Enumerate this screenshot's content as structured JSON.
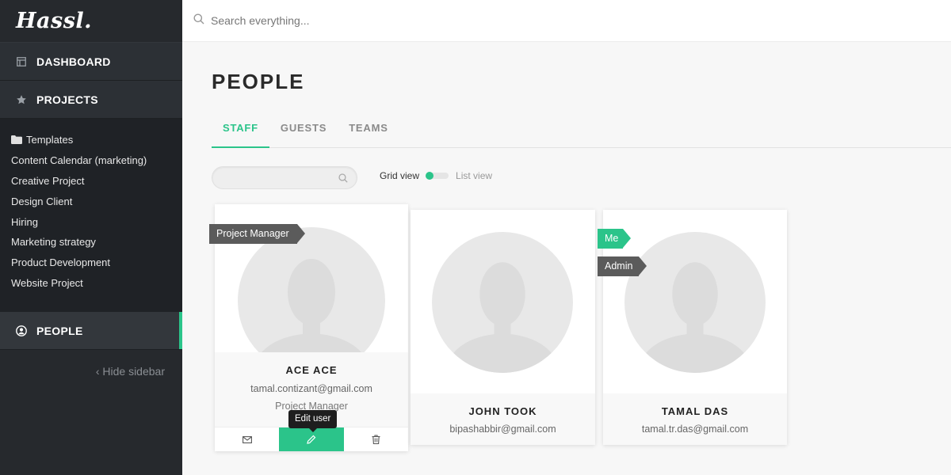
{
  "app": {
    "logo": "Hassl."
  },
  "sidebar": {
    "nav": [
      {
        "label": "DASHBOARD",
        "icon": "calendar-icon"
      },
      {
        "label": "PROJECTS",
        "icon": "star-icon"
      }
    ],
    "projects": [
      {
        "label": "Templates",
        "icon": "folder-icon"
      },
      {
        "label": "Content Calendar (marketing)"
      },
      {
        "label": "Creative Project"
      },
      {
        "label": "Design Client"
      },
      {
        "label": "Hiring"
      },
      {
        "label": "Marketing strategy"
      },
      {
        "label": "Product Development"
      },
      {
        "label": "Website Project"
      }
    ],
    "people": {
      "label": "PEOPLE",
      "icon": "user-circle-icon"
    },
    "hide_sidebar": "Hide sidebar"
  },
  "search": {
    "placeholder": "Search everything..."
  },
  "page": {
    "title": "PEOPLE",
    "tabs": [
      "STAFF",
      "GUESTS",
      "TEAMS"
    ],
    "active_tab": "STAFF",
    "people_search_placeholder": "",
    "view_toggle": {
      "grid": "Grid view",
      "list": "List view",
      "selected": "Grid view"
    }
  },
  "people": [
    {
      "name": "ACE ACE",
      "email": "tamal.contizant@gmail.com",
      "role": "Project Manager",
      "ribbons": [
        "Project Manager"
      ]
    },
    {
      "name": "JOHN TOOK",
      "email": "bipashabbir@gmail.com",
      "role": "",
      "ribbons": []
    },
    {
      "name": "TAMAL DAS",
      "email": "tamal.tr.das@gmail.com",
      "role": "",
      "ribbons": [
        "Me",
        "Admin"
      ]
    }
  ],
  "tooltip": {
    "text": "Edit user"
  },
  "colors": {
    "accent": "#2bc48a",
    "sidebar_bg": "#26292d",
    "ribbon_dark": "#5b5b5b"
  }
}
